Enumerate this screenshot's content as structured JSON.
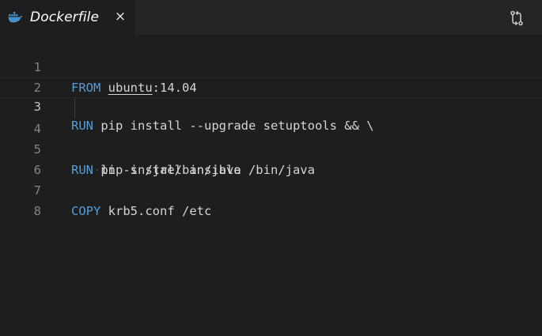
{
  "tab": {
    "title": "Dockerfile",
    "close_glyph": "×",
    "icon": "docker-whale-icon"
  },
  "toolbar": {
    "action_icon": "source-control-compare-icon"
  },
  "colors": {
    "background": "#1e1e1e",
    "keyword": "#569cd6",
    "text": "#d4d4d4",
    "line_number": "#858585",
    "docker_blue": "#4a90c8"
  },
  "editor": {
    "current_line": 3,
    "lines": [
      {
        "number": "1",
        "keyword": "FROM",
        "rest_a": "ubuntu",
        "rest_b": ":14.04"
      },
      {
        "number": "2",
        "keyword": "",
        "rest_a": "",
        "rest_b": ""
      },
      {
        "number": "3",
        "keyword": "RUN",
        "rest_a": "pip install --upgrade setuptools && \\",
        "rest_b": ""
      },
      {
        "number": "4",
        "keyword": "",
        "rest_a": "pip install ansible",
        "rest_b": ""
      },
      {
        "number": "5",
        "keyword": "RUN",
        "rest_a": "ln -s /jre/bin/java /bin/java",
        "rest_b": ""
      },
      {
        "number": "6",
        "keyword": "",
        "rest_a": "",
        "rest_b": ""
      },
      {
        "number": "7",
        "keyword": "COPY",
        "rest_a": "krb5.conf /etc",
        "rest_b": ""
      },
      {
        "number": "8",
        "keyword": "",
        "rest_a": "",
        "rest_b": ""
      }
    ]
  }
}
